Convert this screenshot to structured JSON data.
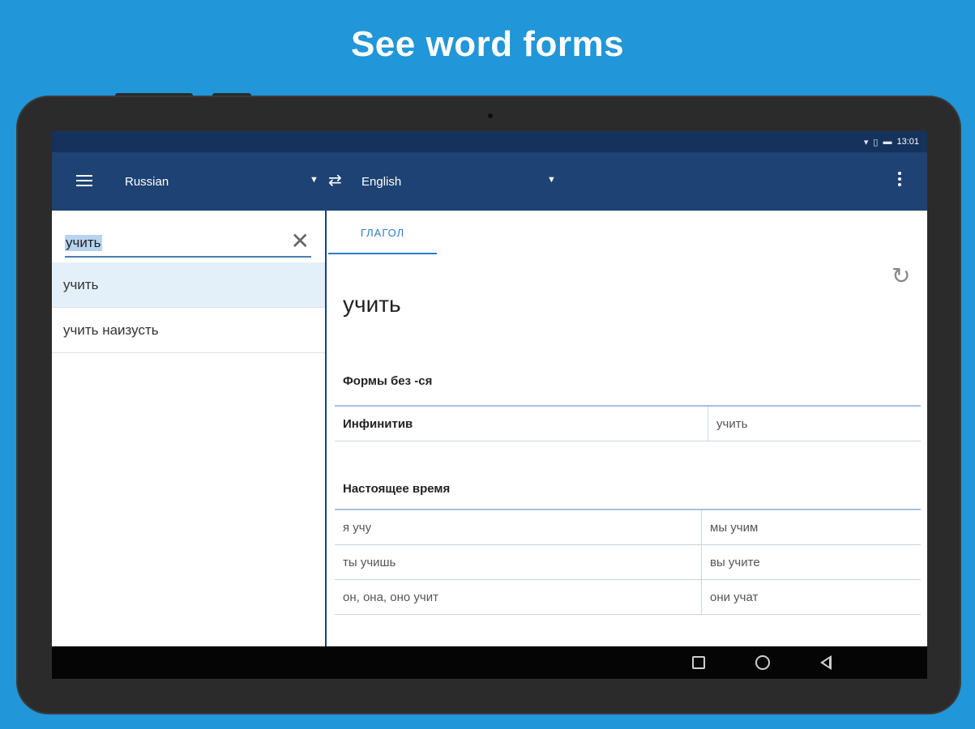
{
  "headline": "See word forms",
  "status": {
    "icons": [
      "wifi-icon",
      "sim-icon",
      "battery-icon"
    ],
    "time": "13:01"
  },
  "appbar": {
    "source_language": "Russian",
    "target_language": "English"
  },
  "search": {
    "value": "учить"
  },
  "suggestions": [
    "учить",
    "учить наизусть"
  ],
  "tab": "ГЛАГОЛ",
  "entry": {
    "word": "учить",
    "section1_title": "Формы без -ся",
    "infinitive_label": "Инфинитив",
    "infinitive_value": "учить",
    "section2_title": "Настоящее время",
    "present": [
      [
        "я учу",
        "мы учим"
      ],
      [
        "ты учишь",
        "вы учите"
      ],
      [
        "он, она, оно учит",
        "они учат"
      ]
    ]
  },
  "colors": {
    "background": "#2196d8",
    "appbar": "#1e4273",
    "statusbar": "#15325c",
    "accent": "#2a7cc7"
  }
}
